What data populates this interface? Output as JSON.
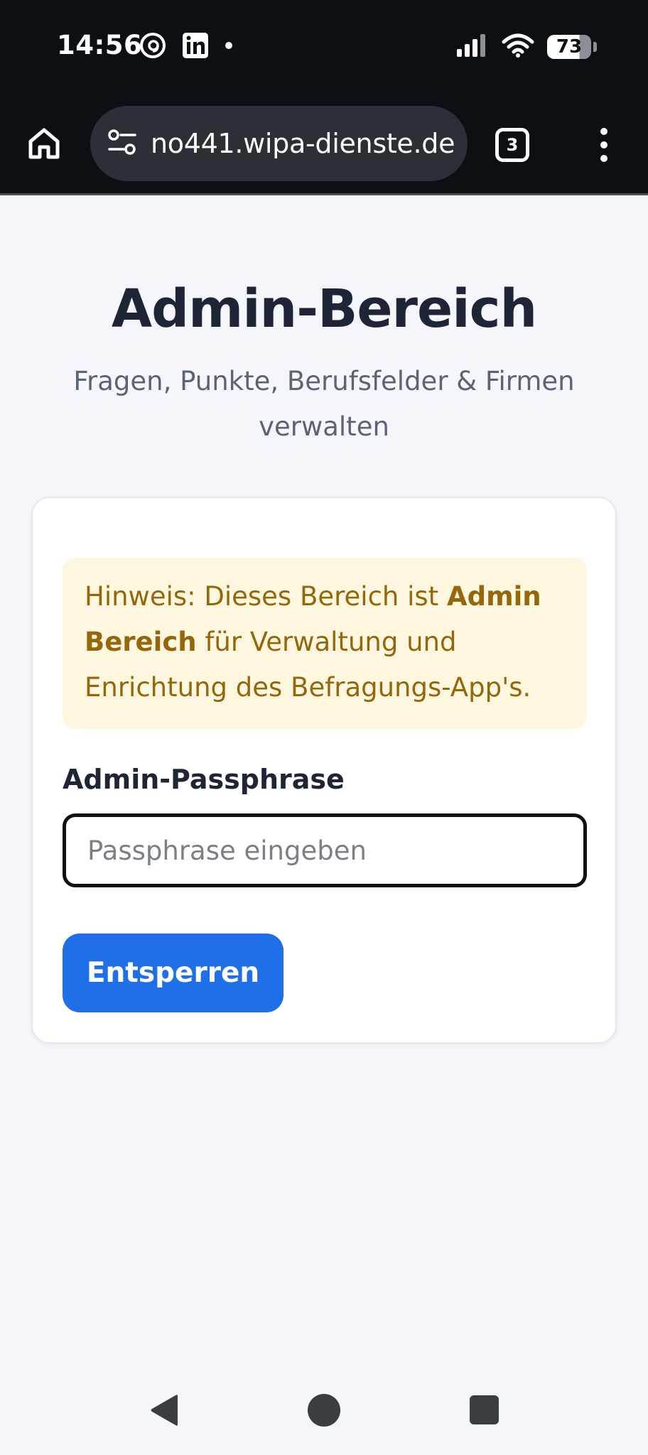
{
  "status_bar": {
    "time": "14:56",
    "battery": "73",
    "icons_left": [
      "threads-icon",
      "linkedin-icon",
      "notification-dot-icon"
    ],
    "icons_right": [
      "signal-icon",
      "wifi-icon",
      "battery-icon"
    ]
  },
  "browser": {
    "url": "no441.wipa-dienste.de",
    "tab_count": "3",
    "icons": [
      "home-icon",
      "site-settings-icon",
      "tabs-icon",
      "more-vert-icon"
    ]
  },
  "page": {
    "title": "Admin-Bereich",
    "subtitle": "Fragen, Punkte, Berufsfelder & Firmen verwalten"
  },
  "notice": {
    "prefix": "Hinweis: Dieses Bereich ist ",
    "bold": "Admin Bereich",
    "suffix": " für Verwaltung und Enrichtung des Befragungs-App's."
  },
  "form": {
    "label": "Admin-Passphrase",
    "placeholder": "Passphrase eingeben",
    "value": "",
    "submit_label": "Entsperren"
  },
  "colors": {
    "primary_button": "#1f6fe6",
    "notice_background": "#fef7e0",
    "notice_text": "#94670b",
    "page_background": "#f4f6fb",
    "title_text": "#1e2536",
    "system_bar": "#0c0f14"
  },
  "nav_bar": {
    "icons": [
      "back-icon",
      "home-circle-icon",
      "recents-icon"
    ]
  }
}
